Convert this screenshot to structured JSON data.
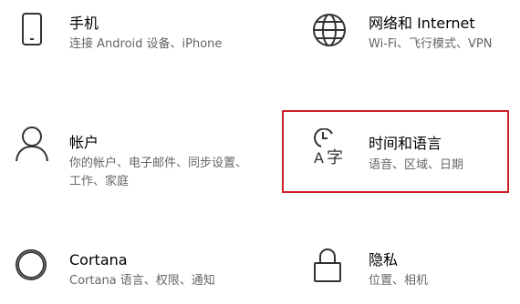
{
  "tiles": [
    {
      "id": "phone",
      "icon": "phone-icon",
      "title": "手机",
      "desc": "连接 Android 设备、iPhone"
    },
    {
      "id": "network",
      "icon": "globe-icon",
      "title": "网络和 Internet",
      "desc": "Wi-Fi、飞行模式、VPN"
    },
    {
      "id": "account",
      "icon": "person-icon",
      "title": "帐户",
      "desc": "你的帐户、电子邮件、同步设置、工作、家庭"
    },
    {
      "id": "time",
      "icon": "time-language-icon",
      "title": "时间和语言",
      "desc": "语音、区域、日期"
    },
    {
      "id": "cortana",
      "icon": "cortana-ring-icon",
      "title": "Cortana",
      "desc": "Cortana 语言、权限、通知"
    },
    {
      "id": "privacy",
      "icon": "lock-icon",
      "title": "隐私",
      "desc": "位置、相机"
    }
  ],
  "highlight_color": "#d0202a"
}
